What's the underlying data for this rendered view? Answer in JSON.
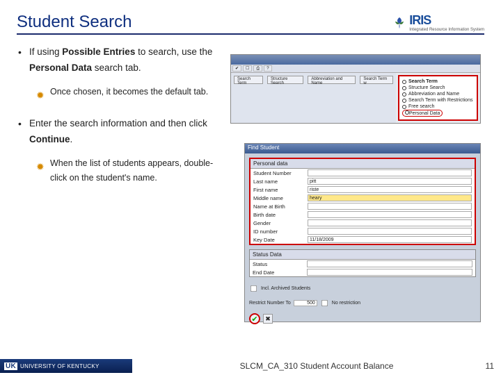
{
  "header": {
    "title": "Student Search",
    "logo_text": "IRIS",
    "logo_sub": "Integrated Resource Information System"
  },
  "bullets": {
    "b1_pre": "If using ",
    "b1_bold1": "Possible Entries",
    "b1_mid": " to search, use the ",
    "b1_bold2": "Personal Data",
    "b1_post": " search tab.",
    "b1_sub": "Once chosen, it becomes the default tab.",
    "b2_pre": "Enter the search information and then click ",
    "b2_bold": "Continue",
    "b2_post": ".",
    "b2_sub": "When the list of students appears, double-click on the student's name."
  },
  "shot1": {
    "tabs": [
      "Search Term",
      "Structure Search",
      "Abbreviation and Name",
      "Search Term w"
    ],
    "side_heading": "Search Term",
    "opts": [
      "Search Term",
      "Structure Search",
      "Abbreviation and Name",
      "Search Term with Restrictions",
      "Free search"
    ],
    "opt_highlight": "Personal Data"
  },
  "shot2": {
    "win_title": "Find Student",
    "panel1_head": "Personal data",
    "rows": [
      {
        "lbl": "Student Number",
        "val": ""
      },
      {
        "lbl": "Last name",
        "val": "pitt"
      },
      {
        "lbl": "First name",
        "val": "riste"
      },
      {
        "lbl": "Middle name",
        "val": "heary"
      },
      {
        "lbl": "Name at Birth",
        "val": ""
      },
      {
        "lbl": "Birth date",
        "val": ""
      },
      {
        "lbl": "Gender",
        "val": ""
      },
      {
        "lbl": "ID number",
        "val": ""
      },
      {
        "lbl": "Key Date",
        "val": "11/18/2009"
      }
    ],
    "panel2_head": "Status Data",
    "rows2": [
      {
        "lbl": "Status",
        "val": ""
      },
      {
        "lbl": "End Date",
        "val": ""
      }
    ],
    "incl_label": "Incl. Archived Students",
    "restrict_lbl": "Restrict Number To",
    "restrict_val": "500",
    "norestrict": "No restriction"
  },
  "footer": {
    "uk": "UK",
    "uk_text": "UNIVERSITY OF KENTUCKY",
    "course": "SLCM_CA_310 Student Account Balance",
    "page": "11"
  }
}
